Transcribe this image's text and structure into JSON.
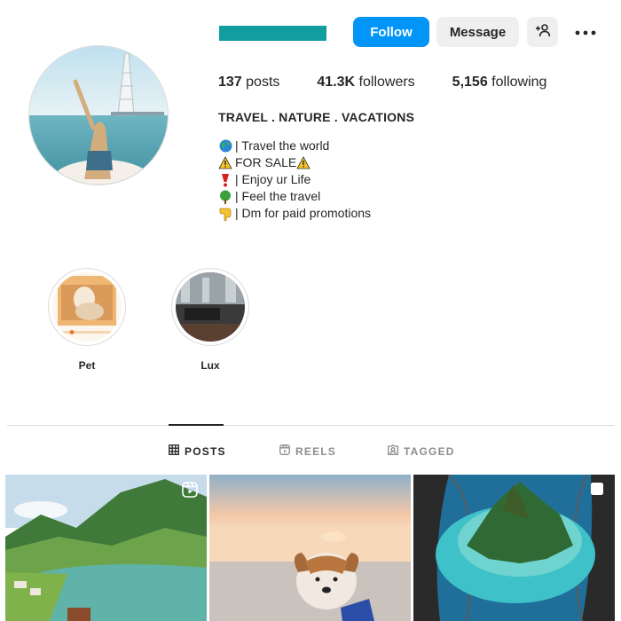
{
  "header": {
    "follow_label": "Follow",
    "message_label": "Message",
    "suggest_icon": "add-person-icon",
    "more_icon": "more-options-icon",
    "username_redacted_color": "#129d9f"
  },
  "stats": {
    "posts_count": "137",
    "posts_label": " posts",
    "followers_count": "41.3K",
    "followers_label": " followers",
    "following_count": "5,156",
    "following_label": " following"
  },
  "bio": {
    "title": "TRAVEL . NATURE . VACATIONS",
    "lines": [
      {
        "icon": "globe-icon",
        "text": "| Travel the world"
      },
      {
        "icon": "warning-icon",
        "text": " FOR SALE "
      },
      {
        "icon": "exclamation-icon",
        "text": "| Enjoy ur Life"
      },
      {
        "icon": "tree-icon",
        "text": "| Feel the travel"
      },
      {
        "icon": "point-down-icon",
        "text": "| Dm for paid promotions"
      }
    ]
  },
  "highlights": [
    {
      "label": "Pet"
    },
    {
      "label": "Lux"
    }
  ],
  "tabs": [
    {
      "label": "POSTS",
      "icon": "grid-icon",
      "active": true
    },
    {
      "label": "REELS",
      "icon": "reels-icon",
      "active": false
    },
    {
      "label": "TAGGED",
      "icon": "tagged-icon",
      "active": false
    }
  ],
  "colors": {
    "accent": "#0095f6",
    "button_gray": "#efefef",
    "text": "#262626",
    "muted": "#8e8e8e"
  }
}
